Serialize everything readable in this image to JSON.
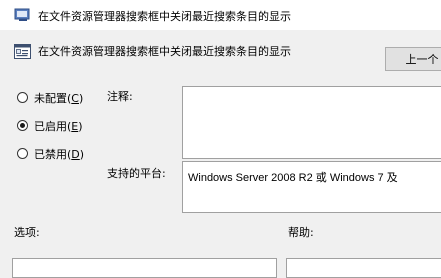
{
  "window": {
    "title": "在文件资源管理器搜索框中关闭最近搜索条目的显示"
  },
  "header": {
    "title": "在文件资源管理器搜索框中关闭最近搜索条目的显示",
    "prev_button": "上一个"
  },
  "settings": {
    "options": [
      {
        "label": "未配置",
        "accel": "C",
        "selected": false
      },
      {
        "label": "已启用",
        "accel": "E",
        "selected": true
      },
      {
        "label": "已禁用",
        "accel": "D",
        "selected": false
      }
    ]
  },
  "comment": {
    "label": "注释:",
    "value": ""
  },
  "platform": {
    "label": "支持的平台:",
    "value": "Windows Server 2008 R2 或 Windows 7 及"
  },
  "sections": {
    "options_label": "选项:",
    "help_label": "帮助:"
  }
}
